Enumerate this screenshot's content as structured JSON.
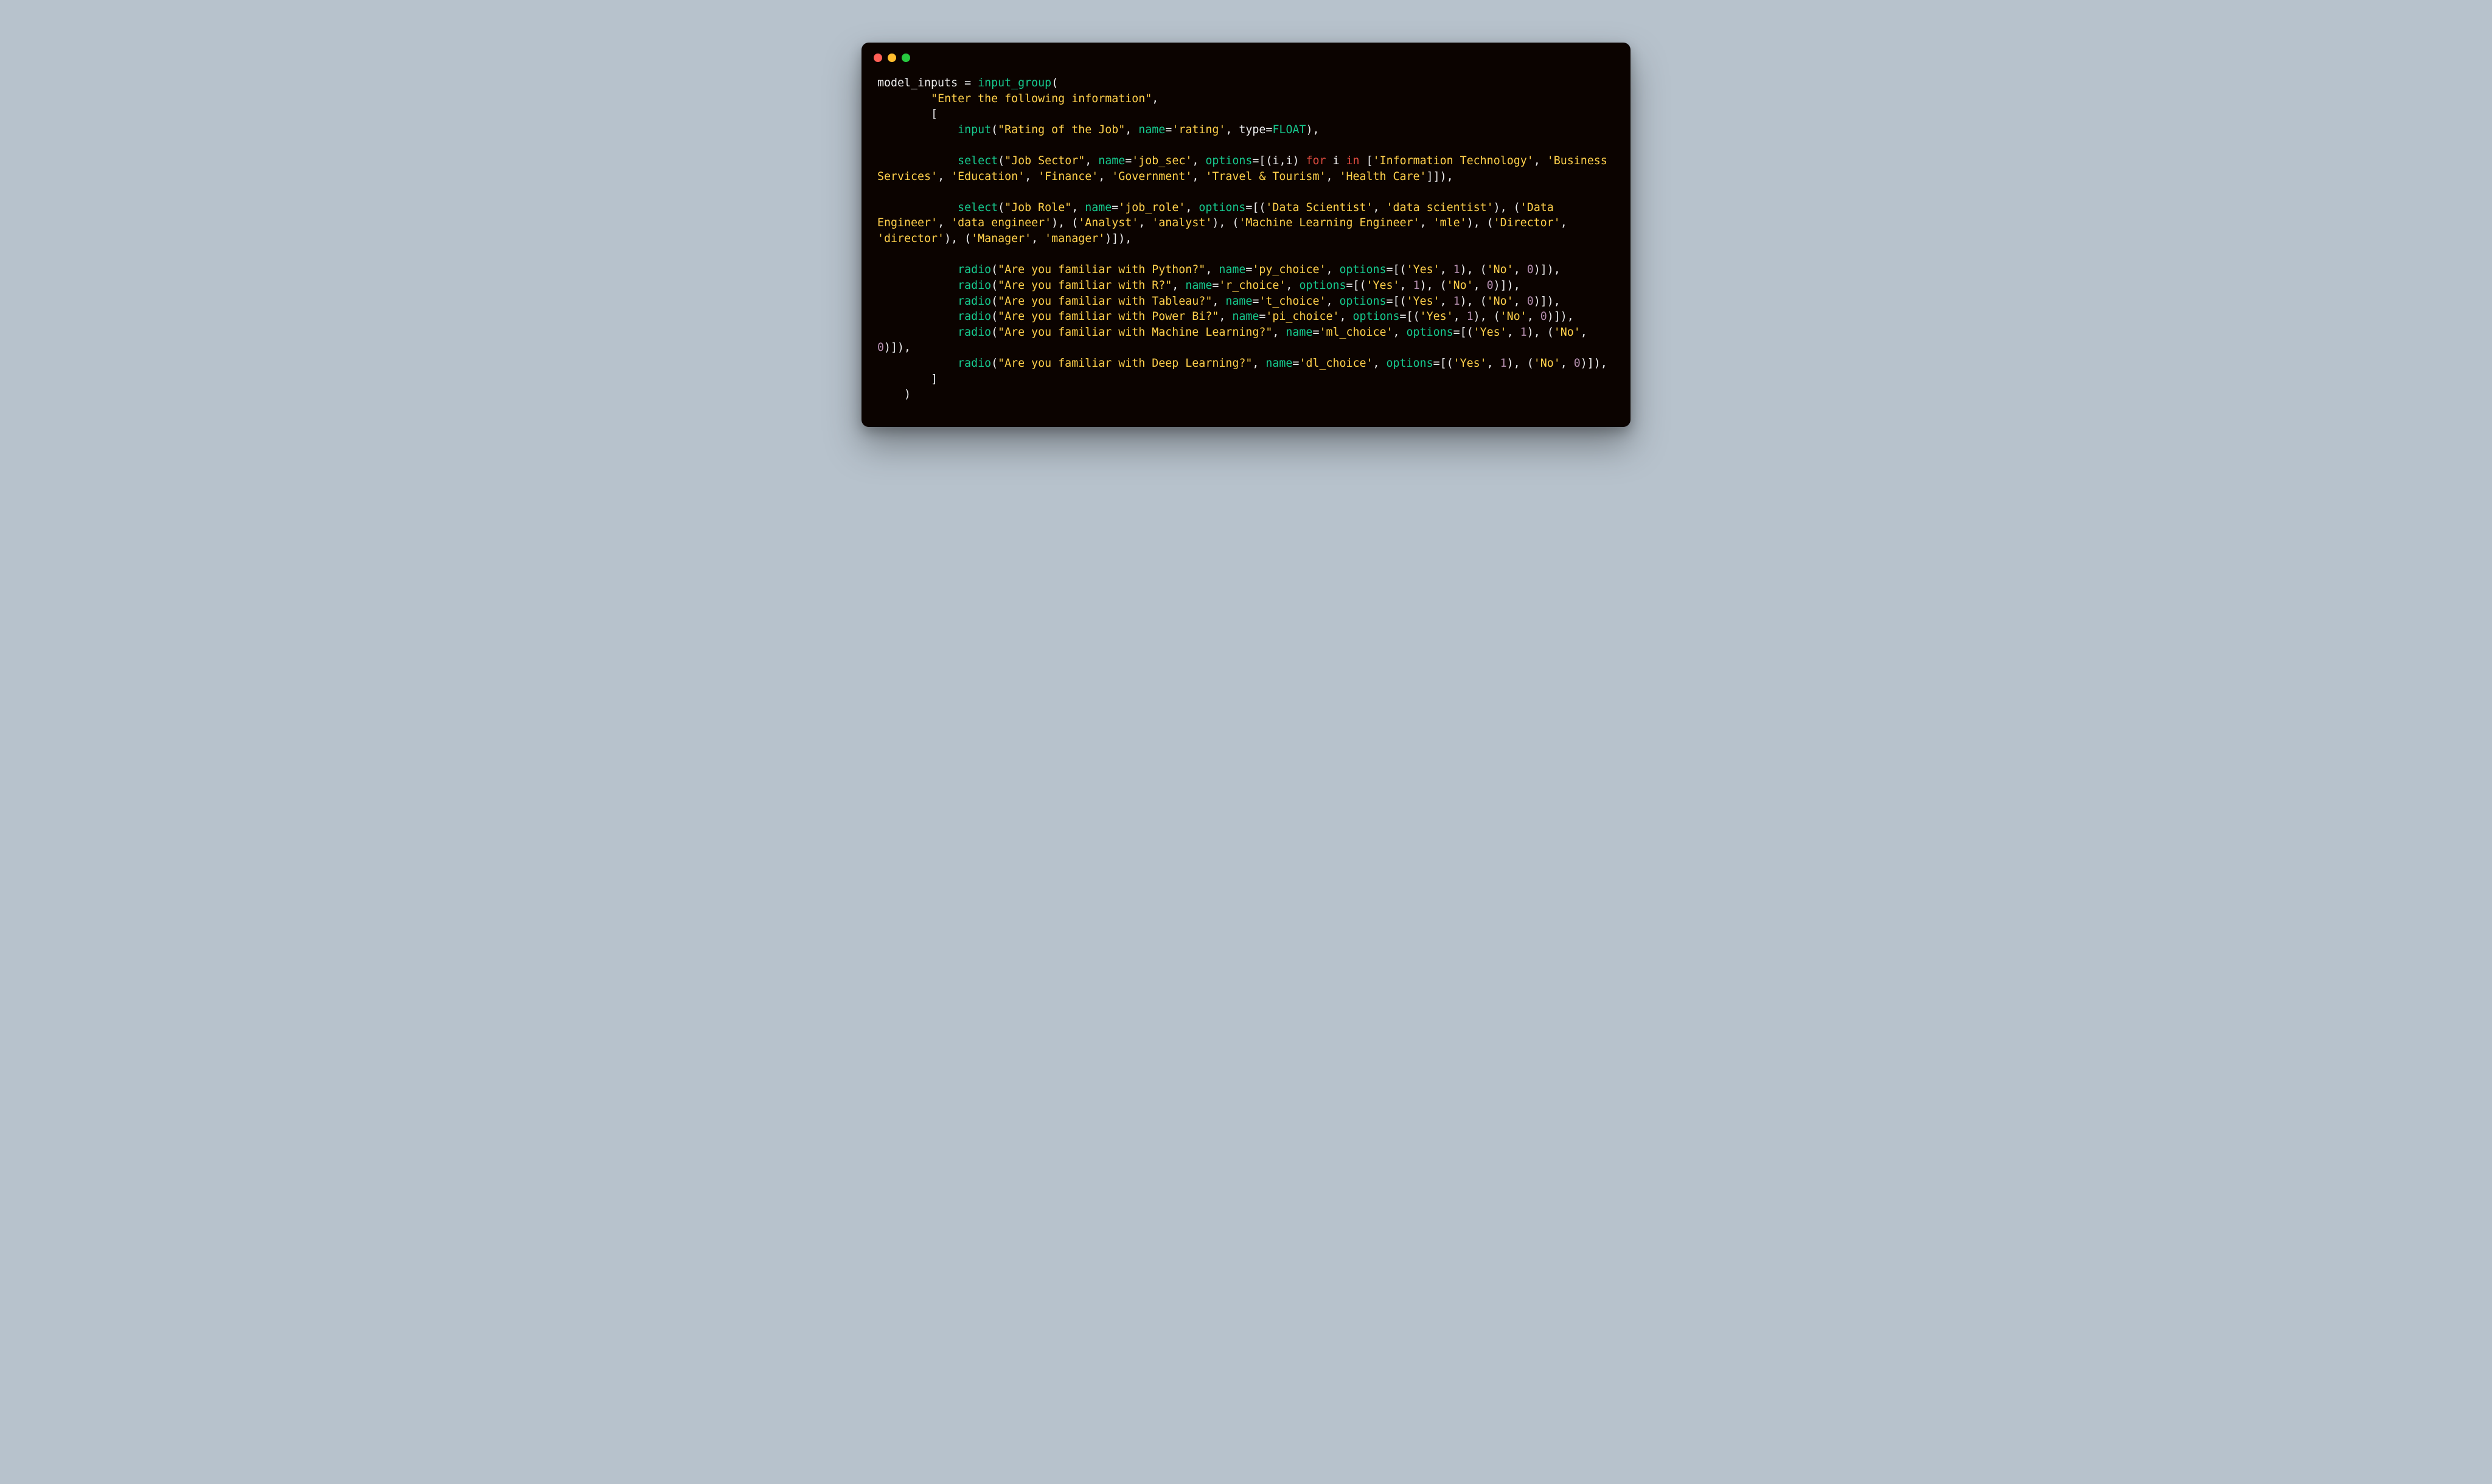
{
  "colors": {
    "bg": "#b7c2cc",
    "window": "#0b0300",
    "dot_red": "#ff5f56",
    "dot_yellow": "#ffbd2e",
    "dot_green": "#27c93f",
    "text": "#e8e8e8",
    "green": "#16c98d",
    "yellow": "#ffd04b",
    "keyword": "#dd4b3e",
    "number": "#b48ead"
  },
  "code": {
    "var_assign": "model_inputs ",
    "eq": "=",
    "fn_input_group": " input_group",
    "paren_open": "(",
    "indent2": "        ",
    "group_title": "\"Enter the following information\"",
    "comma": ",",
    "bracket_open": "[",
    "indent3": "            ",
    "fn_input": "input",
    "s_rating_label": "\"Rating of the Job\"",
    "kw_name": "name",
    "s_rating_name": "'rating'",
    "kw_type": "type",
    "float_const": "FLOAT",
    "close_paren_comma": "),",
    "fn_select": "select",
    "s_jobsec_label": "\"Job Sector\"",
    "s_jobsec_name": "'job_sec'",
    "kw_options": "options",
    "eq_sign": "=",
    "br_open": "[",
    "tuple_ii": "(i,i) ",
    "kw_for": "for",
    "i_sp": " i ",
    "kw_in": "in",
    "sp_br": " [",
    "s_it": "'Information Technology'",
    "s_bs": "'Business Services'",
    "s_ed": "'Education'",
    "s_fin": "'Finance'",
    "s_gov": "'Government'",
    "s_tt": "'Travel & Tourism'",
    "s_hc": "'Health Care'",
    "dbl_br_close": "]]),",
    "s_jobrole_label": "\"Job Role\"",
    "s_jobrole_name": "'job_role'",
    "tup_ds": "'Data Scientist'",
    "tup_ds_v": "'data scientist'",
    "tup_de": "'Data Engineer'",
    "tup_de_v": "'data engineer'",
    "tup_an": "'Analyst'",
    "tup_an_v": "'analyst'",
    "tup_mle": "'Machine Learning Engineer'",
    "tup_mle_v": "'mle'",
    "tup_dir": "'Director'",
    "tup_dir_v": "'director'",
    "tup_mgr": "'Manager'",
    "tup_mgr_v": "'manager'",
    "br_close_paren": "]),",
    "fn_radio": "radio",
    "s_py_q": "\"Are you familiar with Python?\"",
    "s_py_name": "'py_choice'",
    "s_r_q": "\"Are you familiar with R?\"",
    "s_r_name": "'r_choice'",
    "s_t_q": "\"Are you familiar with Tableau?\"",
    "s_t_name": "'t_choice'",
    "s_pi_q": "\"Are you familiar with Power Bi?\"",
    "s_pi_name": "'pi_choice'",
    "s_ml_q": "\"Are you familiar with Machine Learning?\"",
    "s_ml_name": "'ml_choice'",
    "s_dl_q": "\"Are you familiar with Deep Learning?\"",
    "s_dl_name": "'dl_choice'",
    "s_yes": "'Yes'",
    "s_no": "'No'",
    "n1": "1",
    "n0": "0",
    "yn_tail": ")]),",
    "bracket_close": "]",
    "indent1b": "    ",
    "paren_close": ")"
  }
}
